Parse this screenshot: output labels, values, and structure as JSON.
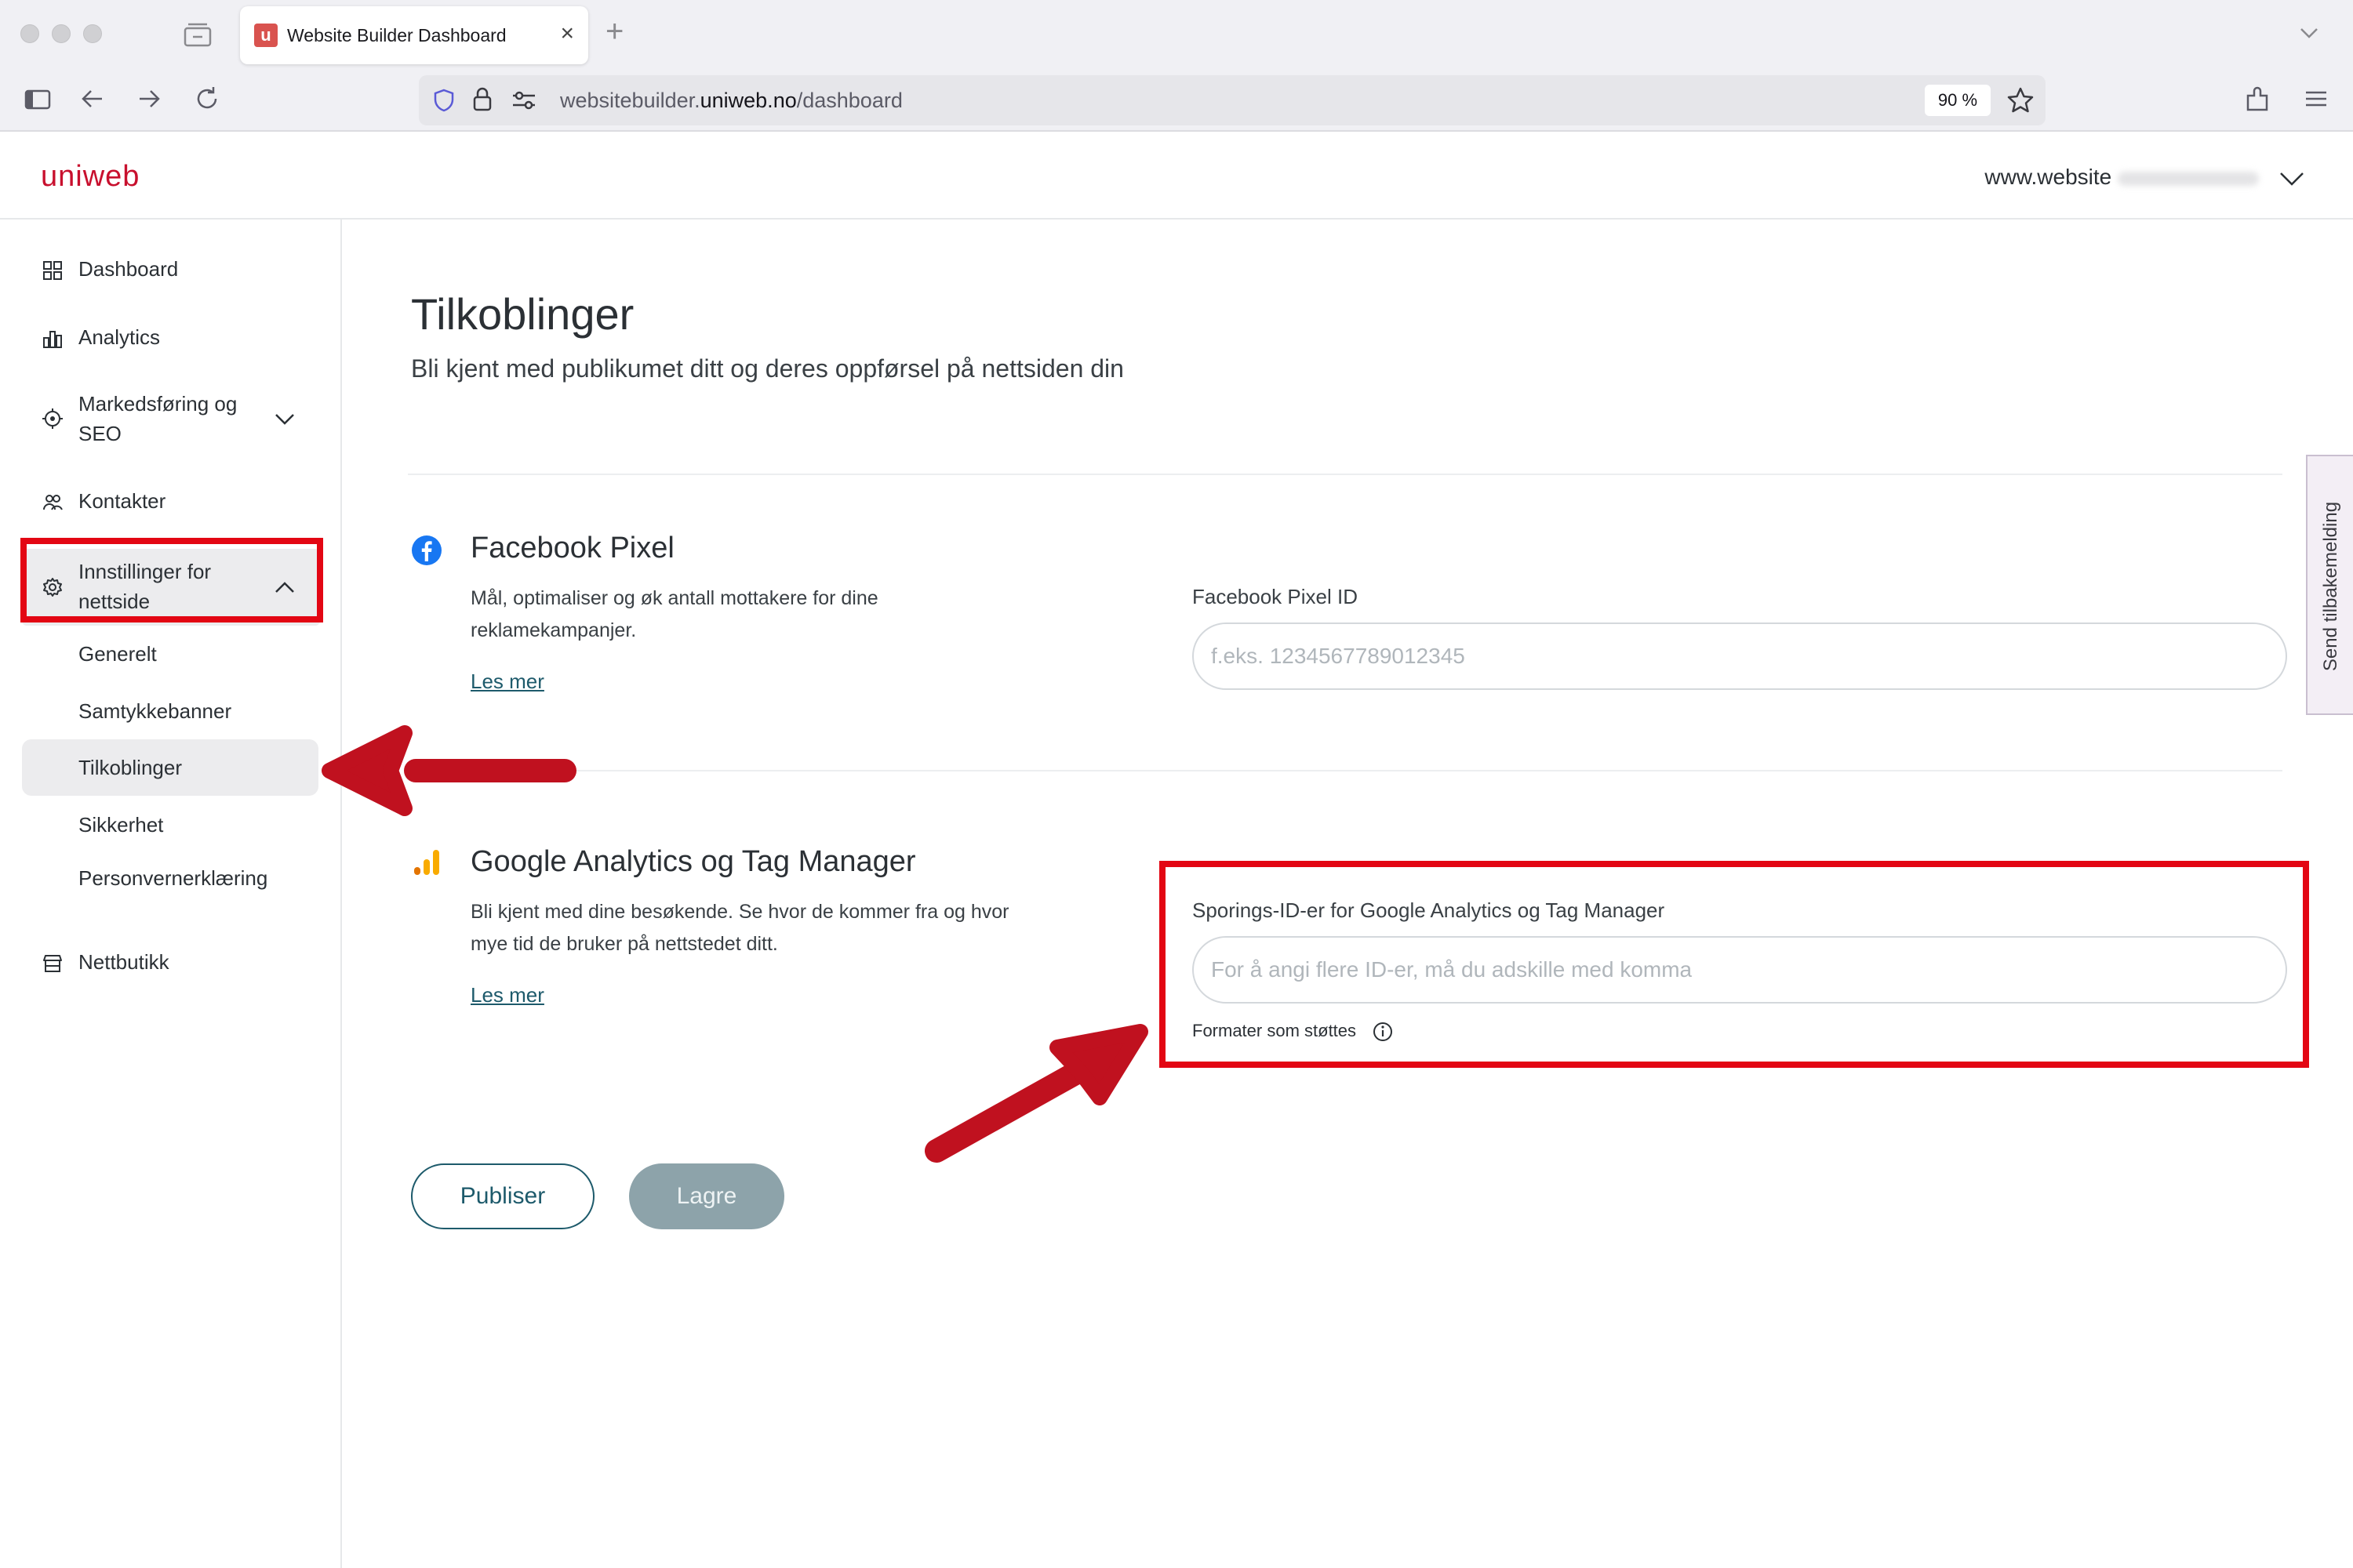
{
  "browser": {
    "tab_title": "Website Builder Dashboard",
    "tab_favicon_letter": "u",
    "url_prefix": "websitebuilder.",
    "url_domain": "uniweb.no",
    "url_path": "/dashboard",
    "zoom": "90 %"
  },
  "header": {
    "logo": "uniweb",
    "site_select": "www.website"
  },
  "sidebar": {
    "items": [
      {
        "label": "Dashboard",
        "icon": "grid-icon"
      },
      {
        "label": "Analytics",
        "icon": "bar-chart-icon"
      },
      {
        "label": "Markedsføring og SEO",
        "icon": "target-icon"
      },
      {
        "label": "Kontakter",
        "icon": "people-icon"
      },
      {
        "label": "Innstillinger for nettside",
        "icon": "gear-icon"
      },
      {
        "label": "Nettbutikk",
        "icon": "store-icon"
      }
    ],
    "subitems": [
      {
        "label": "Generelt"
      },
      {
        "label": "Samtykkebanner"
      },
      {
        "label": "Tilkoblinger",
        "active": true
      },
      {
        "label": "Sikkerhet"
      },
      {
        "label": "Personvernerklæring"
      }
    ]
  },
  "main": {
    "title": "Tilkoblinger",
    "subtitle": "Bli kjent med publikumet ditt og deres oppførsel på nettsiden din",
    "facebook": {
      "title": "Facebook Pixel",
      "description": "Mål, optimaliser og øk antall mottakere for dine reklamekampanjer.",
      "link": "Les mer",
      "field_label": "Facebook Pixel ID",
      "placeholder": "f.eks. 1234567789012345"
    },
    "google": {
      "title": "Google Analytics og Tag Manager",
      "description": "Bli kjent med dine besøkende. Se hvor de kommer fra og hvor mye tid de bruker på nettstedet ditt.",
      "link": "Les mer",
      "field_label": "Sporings-ID-er for Google Analytics og Tag Manager",
      "placeholder": "For å angi flere ID-er, må du adskille med komma",
      "formats_hint": "Formater som støttes"
    },
    "buttons": {
      "publish": "Publiser",
      "save": "Lagre"
    }
  },
  "feedback_tab": "Send tilbakemelding",
  "colors": {
    "brand": "#c8102e",
    "link": "#1d5a6b",
    "annotation": "#e30613",
    "facebook": "#1877f2",
    "google_orange": "#f9ab00"
  }
}
